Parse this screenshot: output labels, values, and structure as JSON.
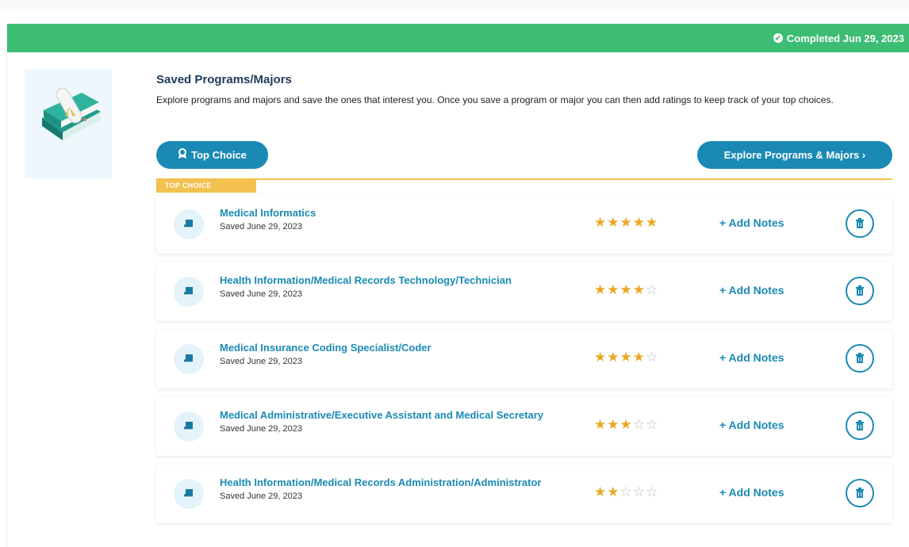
{
  "banner": {
    "status": "Completed Jun 29, 2023"
  },
  "section": {
    "title": "Saved Programs/Majors",
    "description": "Explore programs and majors and save the ones that interest you. Once you save a program or major you can then add ratings to keep track of your top choices."
  },
  "buttons": {
    "top_choice": "Top Choice",
    "explore": "Explore Programs & Majors ›"
  },
  "top_choice_tag": "TOP CHOICE",
  "icons": {
    "book": "book-icon",
    "trash": "trash-icon",
    "award": "award-icon",
    "check": "check-circle-icon"
  },
  "colors": {
    "banner": "#3dbd73",
    "accent": "#1a8ab4",
    "star": "#e9a824",
    "top_choice": "#f2c14f"
  },
  "programs": [
    {
      "name": "Medical Informatics",
      "saved": "Saved June 29, 2023",
      "rating": 5,
      "notes": "+ Add Notes"
    },
    {
      "name": "Health Information/Medical Records Technology/Technician",
      "saved": "Saved June 29, 2023",
      "rating": 4,
      "notes": "+ Add Notes"
    },
    {
      "name": "Medical Insurance Coding Specialist/Coder",
      "saved": "Saved June 29, 2023",
      "rating": 4,
      "notes": "+ Add Notes"
    },
    {
      "name": "Medical Administrative/Executive Assistant and Medical Secretary",
      "saved": "Saved June 29, 2023",
      "rating": 3,
      "notes": "+ Add Notes"
    },
    {
      "name": "Health Information/Medical Records Administration/Administrator",
      "saved": "Saved June 29, 2023",
      "rating": 2,
      "notes": "+ Add Notes"
    }
  ]
}
